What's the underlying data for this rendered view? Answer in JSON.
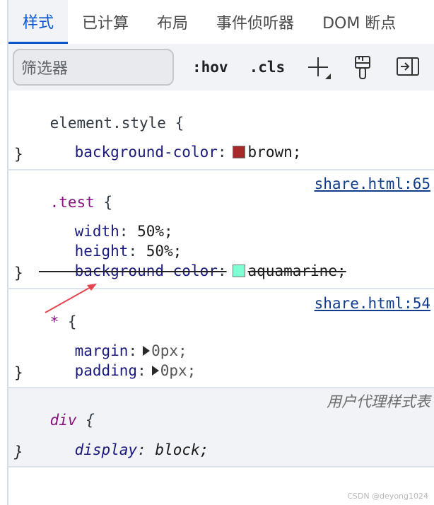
{
  "tabs": [
    {
      "label": "样式",
      "active": true
    },
    {
      "label": "已计算"
    },
    {
      "label": "布局"
    },
    {
      "label": "事件侦听器"
    },
    {
      "label": "DOM 断点"
    }
  ],
  "toolbar": {
    "filter_placeholder": "筛选器",
    "hov_label": ":hov",
    "cls_label": ".cls",
    "icons": [
      "new-style-rule-icon",
      "paint-brush-icon",
      "toggle-sidebar-icon"
    ]
  },
  "rules": {
    "element_style": {
      "selector": "element.style",
      "open": "{",
      "close": "}",
      "decl": {
        "prop": "background-color",
        "colon": ":",
        "value": "brown;",
        "swatch": "#a52a2a"
      }
    },
    "test": {
      "selector": ".test",
      "open": "{",
      "close": "}",
      "source": "share.html:65",
      "decls": [
        {
          "prop": "width",
          "colon": ":",
          "value": "50%;"
        },
        {
          "prop": "height",
          "colon": ":",
          "value": "50%;"
        },
        {
          "prop": "background-color",
          "colon": ":",
          "value": "aquamarine;",
          "swatch": "#7fffd4",
          "overridden": true
        }
      ]
    },
    "universal": {
      "selector": "*",
      "open": "{",
      "close": "}",
      "source": "share.html:54",
      "decls": [
        {
          "prop": "margin",
          "colon": ":",
          "value": "0px;"
        },
        {
          "prop": "padding",
          "colon": ":",
          "value": "0px;"
        }
      ]
    },
    "div": {
      "selector": "div",
      "open": "{",
      "close": "}",
      "source": "用户代理样式表",
      "decl": {
        "prop": "display",
        "colon": ":",
        "value": "block;"
      }
    }
  },
  "annotation_color": "#e8444f",
  "watermark": "CSDN @deyong1024"
}
